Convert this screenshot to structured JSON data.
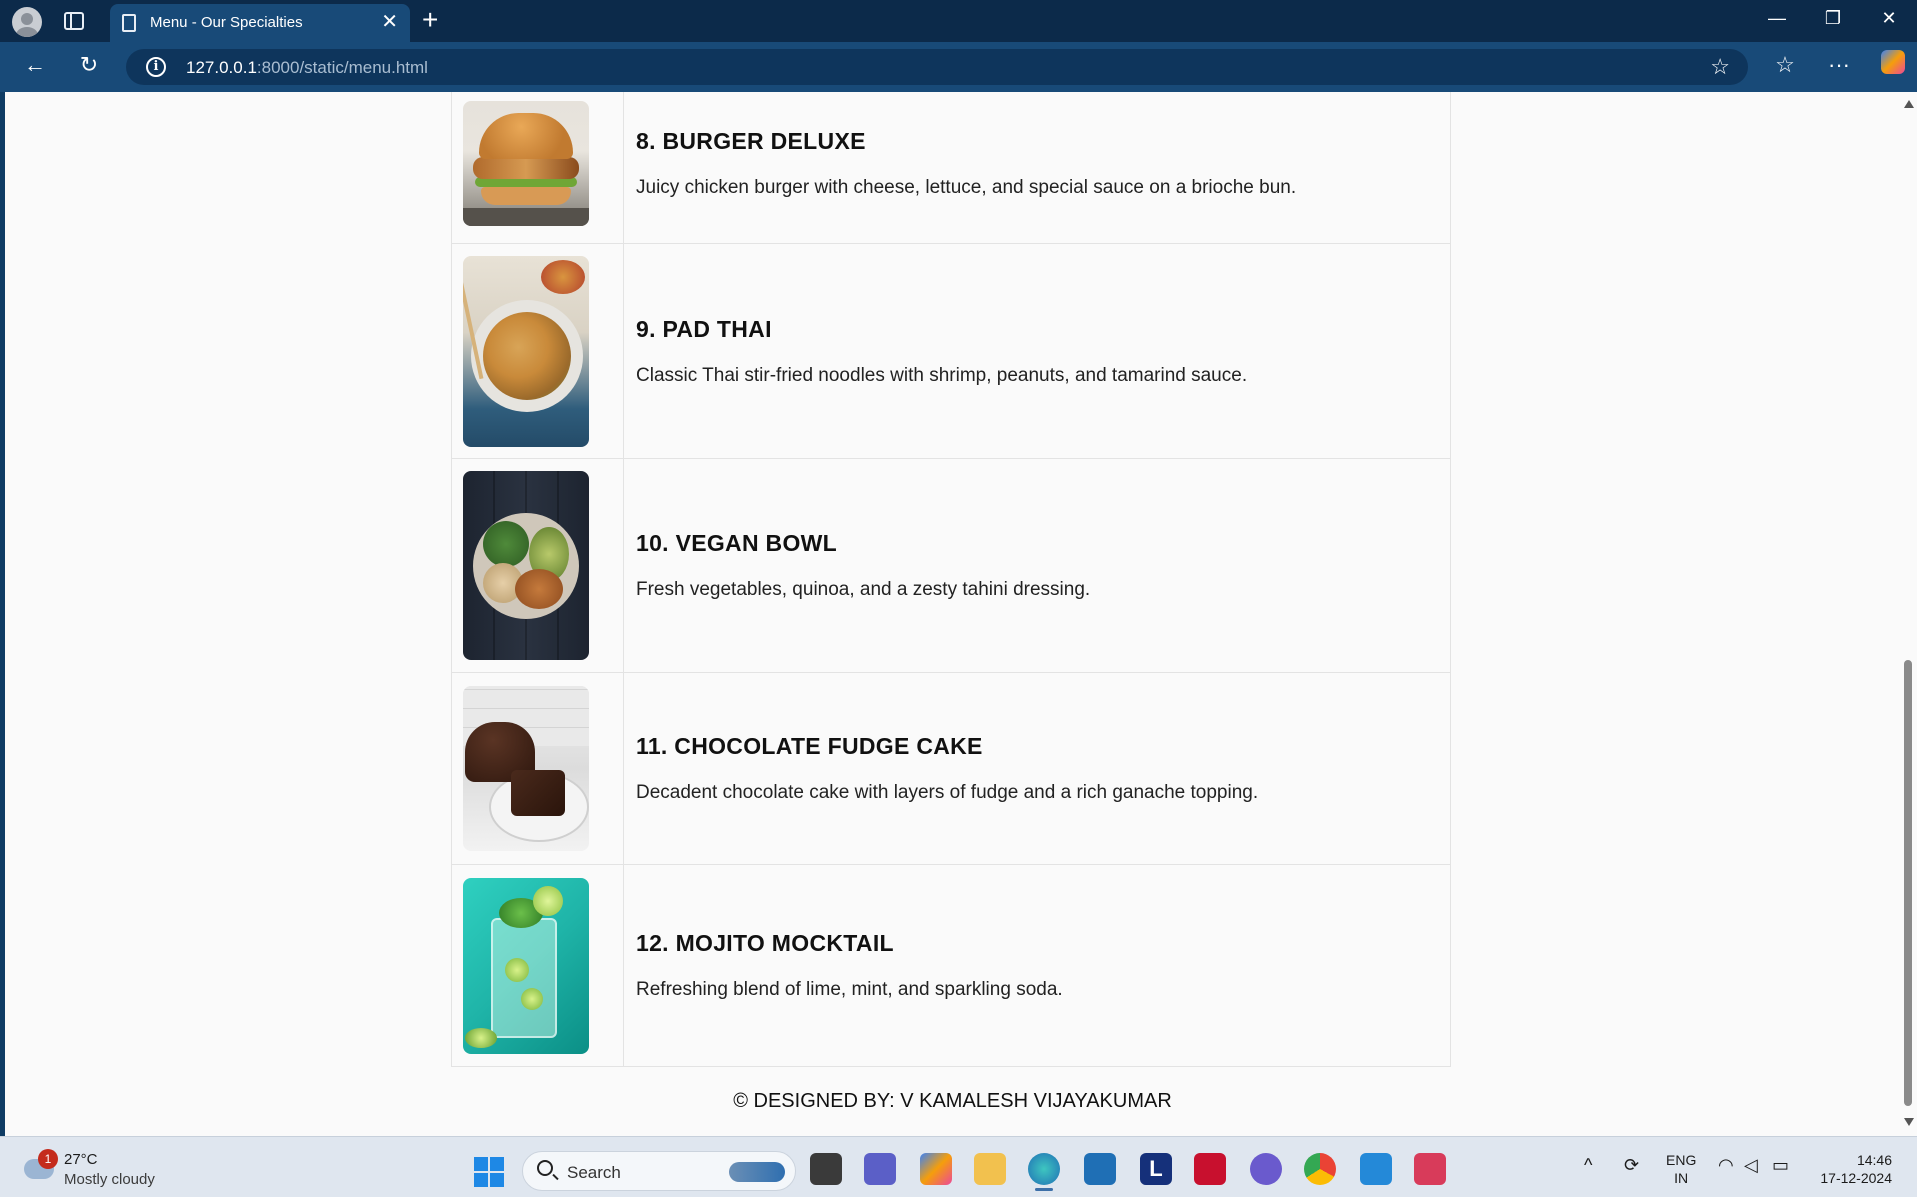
{
  "browser": {
    "tab_title": "Menu - Our Specialties",
    "url_host": "127.0.0.1",
    "url_path": ":8000/static/menu.html"
  },
  "menu": {
    "items": [
      {
        "name": "8. BURGER DELUXE",
        "description": "Juicy chicken burger with cheese, lettuce, and special sauce on a brioche bun.",
        "image": "burger-image"
      },
      {
        "name": "9. PAD THAI",
        "description": "Classic Thai stir-fried noodles with shrimp, peanuts, and tamarind sauce.",
        "image": "pad-thai-image"
      },
      {
        "name": "10. VEGAN BOWL",
        "description": "Fresh vegetables, quinoa, and a zesty tahini dressing.",
        "image": "vegan-bowl-image"
      },
      {
        "name": "11. CHOCOLATE FUDGE CAKE",
        "description": "Decadent chocolate cake with layers of fudge and a rich ganache topping.",
        "image": "chocolate-cake-image"
      },
      {
        "name": "12. MOJITO MOCKTAIL",
        "description": "Refreshing blend of lime, mint, and sparkling soda.",
        "image": "mojito-image"
      }
    ]
  },
  "footer": {
    "credit": "© DESIGNED BY: V KAMALESH VIJAYAKUMAR"
  },
  "taskbar": {
    "weather_badge": "1",
    "weather_temp": "27°C",
    "weather_desc": "Mostly cloudy",
    "search_placeholder": "Search",
    "lang_line1": "ENG",
    "lang_line2": "IN",
    "time": "14:46",
    "date": "17-12-2024"
  },
  "colors": {
    "titlebar": "#0c2a4a",
    "toolbar": "#184a78",
    "page_bg": "#fafafa",
    "taskbar": "#dfe6ef"
  }
}
